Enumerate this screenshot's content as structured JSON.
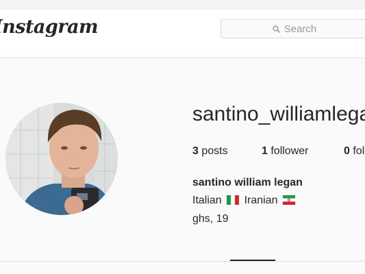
{
  "header": {
    "logo_text": "Instagram",
    "search": {
      "placeholder": "Search",
      "icon": "search-icon"
    }
  },
  "profile": {
    "username": "santino_williamlegan",
    "stats": {
      "posts_count": "3",
      "posts_label": " posts",
      "followers_count": "1",
      "followers_label": " follower",
      "following_count": "0",
      "following_label": " following"
    },
    "full_name": "santino william legan",
    "bio": {
      "line1_part1": "Italian",
      "line1_part2": "Iranian",
      "line2": "ghs, 19"
    },
    "flags": [
      "flag-italy-icon",
      "flag-iran-icon"
    ]
  },
  "colors": {
    "text": "#262626",
    "border": "#dbdbdb",
    "background": "#fafafa",
    "placeholder": "#9a9a9a"
  }
}
